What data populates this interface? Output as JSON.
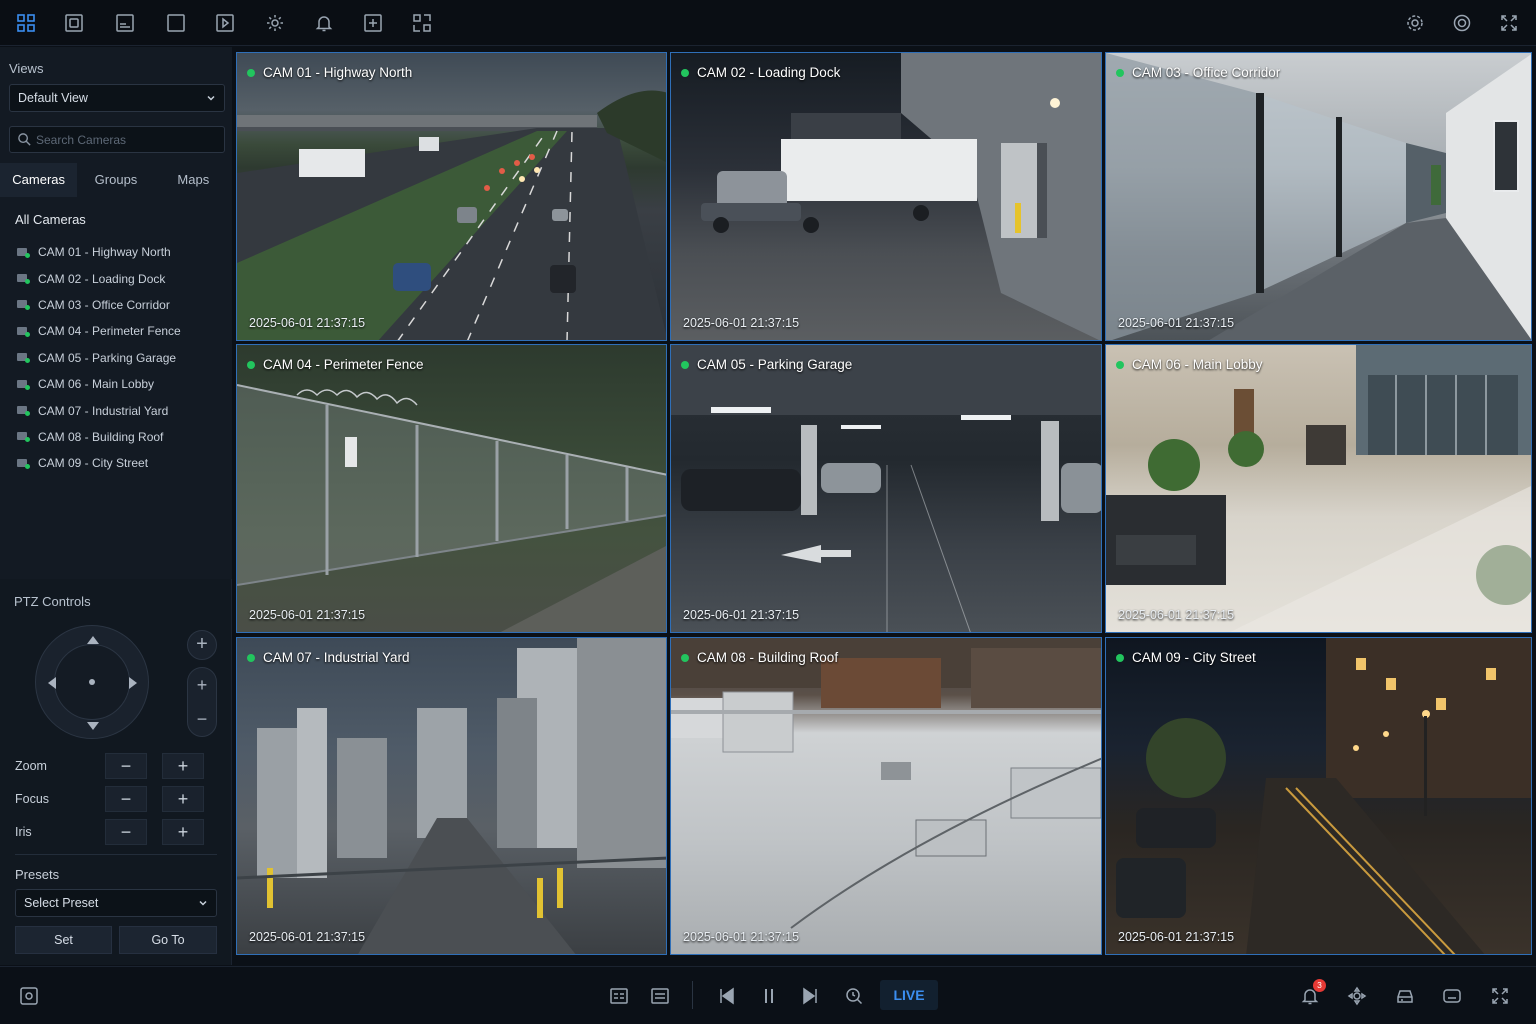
{
  "sidebar": {
    "views_label": "Views",
    "view_select": "Default View",
    "search_placeholder": "Search Cameras",
    "tabs": [
      {
        "label": "Cameras",
        "active": true
      },
      {
        "label": "Groups",
        "active": false
      },
      {
        "label": "Maps",
        "active": false
      }
    ],
    "all_cameras_label": "All Cameras",
    "camera_list": [
      "CAM 01 - Highway North",
      "CAM 02 - Loading Dock",
      "CAM 03 - Office Corridor",
      "CAM 04 - Perimeter Fence",
      "CAM 05 - Parking Garage",
      "CAM 06 - Main Lobby",
      "CAM 07 - Industrial Yard",
      "CAM 08 - Building Roof",
      "CAM 09 - City Street"
    ],
    "ptz": {
      "label": "PTZ Controls",
      "zoom_label": "Zoom",
      "focus_label": "Focus",
      "iris_label": "Iris",
      "minus": "−",
      "plus": "+"
    },
    "presets": {
      "label": "Presets",
      "select": "Select Preset",
      "set_label": "Set",
      "goto_label": "Go To"
    }
  },
  "cameras": [
    {
      "title": "CAM 01 - Highway North",
      "timestamp": "2025-06-01  21:37:15"
    },
    {
      "title": "CAM 02 - Loading Dock",
      "timestamp": "2025-06-01  21:37:15"
    },
    {
      "title": "CAM 03 - Office Corridor",
      "timestamp": "2025-06-01  21:37:15"
    },
    {
      "title": "CAM 04 - Perimeter Fence",
      "timestamp": "2025-06-01  21:37:15"
    },
    {
      "title": "CAM 05 - Parking Garage",
      "timestamp": "2025-06-01  21:37:15"
    },
    {
      "title": "CAM 06 - Main Lobby",
      "timestamp": "2025-06-01  21:37:15"
    },
    {
      "title": "CAM 07 - Industrial Yard",
      "timestamp": "2025-06-01  21:37:15"
    },
    {
      "title": "CAM 08 - Building Roof",
      "timestamp": "2025-06-01  21:37:15"
    },
    {
      "title": "CAM 09 - City Street",
      "timestamp": "2025-06-01  21:37:15"
    }
  ],
  "bottombar": {
    "live_label": "LIVE",
    "alert_count": "3"
  },
  "colors": {
    "accent": "#3b8ef0",
    "live_dot": "#22c55e",
    "tile_border": "#2f6fb8",
    "badge": "#e53935"
  },
  "icons": {
    "topbar_left": [
      "grid-layout-icon",
      "camera-view-icon",
      "playback-icon",
      "single-view-icon",
      "video-export-icon",
      "settings-icon",
      "alarm-bell-icon",
      "add-device-icon",
      "map-layout-icon"
    ],
    "topbar_right": [
      "gear-icon",
      "user-settings-icon",
      "fullscreen-icon"
    ],
    "bottombar": [
      "snapshot-icon",
      "layout-icon",
      "list-icon",
      "skip-back-icon",
      "pause-icon",
      "skip-forward-icon",
      "search-playback-icon",
      "notification-bell-icon",
      "ptz-icon",
      "storage-icon",
      "record-icon",
      "expand-icon"
    ]
  }
}
